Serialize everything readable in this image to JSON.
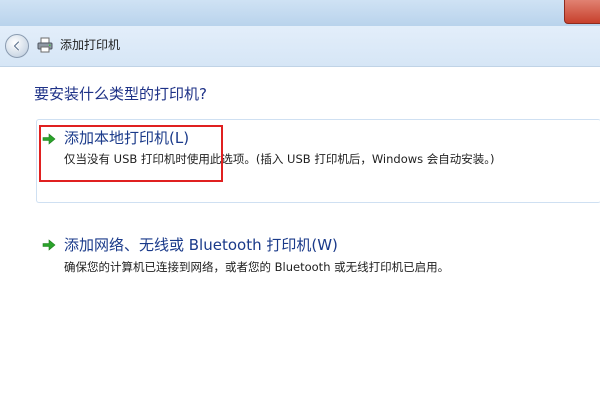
{
  "window": {
    "title": "添加打印机"
  },
  "main": {
    "question": "要安装什么类型的打印机?",
    "options": [
      {
        "title": "添加本地打印机(L)",
        "description": "仅当没有 USB 打印机时使用此选项。(插入 USB 打印机后，Windows 会自动安装。)"
      },
      {
        "title": "添加网络、无线或 Bluetooth 打印机(W)",
        "description": "确保您的计算机已连接到网络，或者您的 Bluetooth 或无线打印机已启用。"
      }
    ]
  },
  "colors": {
    "accent_arrow": "#2aa32a",
    "highlight": "#e02020",
    "heading_text": "#1e3287"
  },
  "icons": [
    "back-arrow-icon",
    "printer-icon",
    "green-arrow-icon"
  ]
}
